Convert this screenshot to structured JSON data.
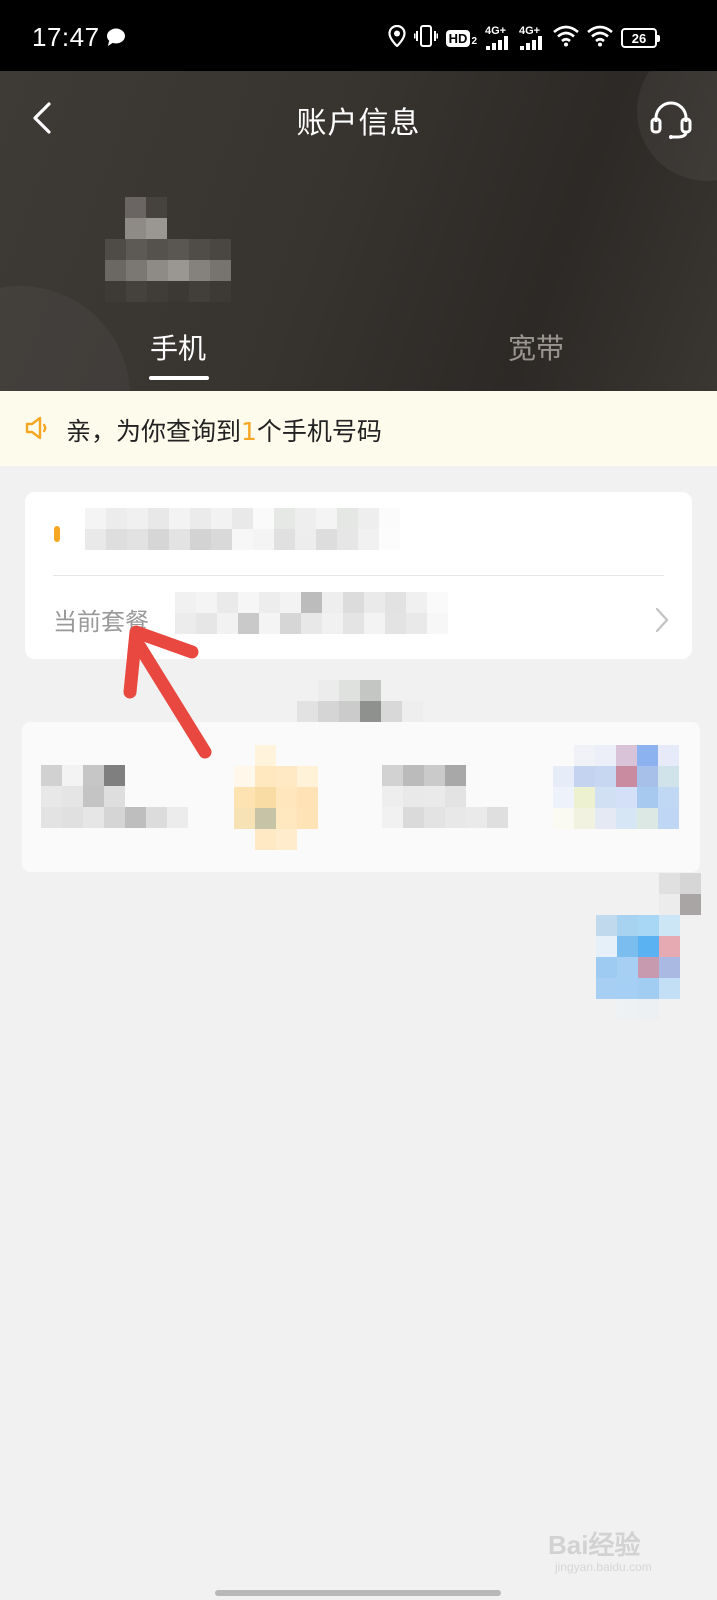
{
  "status_bar": {
    "time": "17:47",
    "network_1": "4G+",
    "network_2": "4G+",
    "hd_badge": "HD",
    "hd_sub": "2",
    "battery": "26",
    "icons": [
      "chat-bubble-icon",
      "location-icon",
      "vibrate-icon",
      "hd-voice-icon",
      "signal-icon",
      "signal-icon",
      "wifi-icon",
      "wifi-icon",
      "battery-icon"
    ]
  },
  "header": {
    "title": "账户信息",
    "back_icon": "chevron-left-icon",
    "support_icon": "headset-icon",
    "tabs": [
      {
        "label": "手机",
        "active": true
      },
      {
        "label": "宽带",
        "active": false
      }
    ]
  },
  "notice": {
    "icon": "speaker-icon",
    "prefix": "亲，为你查询到",
    "count": "1",
    "suffix": "个手机号码"
  },
  "account_card": {
    "plan_label": "当前套餐",
    "chevron_icon": "chevron-right-icon"
  },
  "colors": {
    "accent": "#f5a623",
    "header_bg": "#37332f",
    "annotation": "#e8483f"
  },
  "watermark": {
    "main": "Bai经验",
    "sub": "jingyan.baidu.com"
  }
}
